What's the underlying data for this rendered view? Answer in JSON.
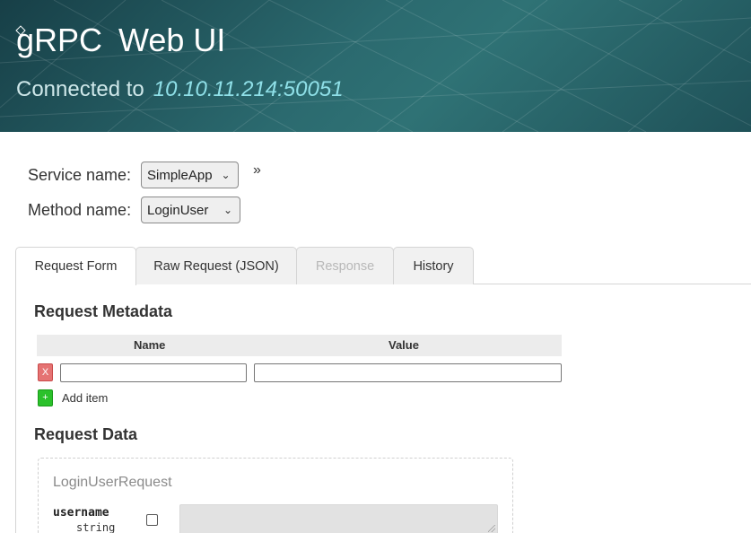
{
  "header": {
    "logo_text": "gRPC",
    "title": "Web UI",
    "connected_label": "Connected to",
    "address": "10.10.11.214:50051"
  },
  "selectors": {
    "service": {
      "label": "Service name:",
      "value": "SimpleApp"
    },
    "method": {
      "label": "Method name:",
      "value": "LoginUser"
    },
    "expand_glyph": "»"
  },
  "tabs": [
    {
      "label": "Request Form",
      "active": true,
      "disabled": false
    },
    {
      "label": "Raw Request (JSON)",
      "active": false,
      "disabled": false
    },
    {
      "label": "Response",
      "active": false,
      "disabled": true
    },
    {
      "label": "History",
      "active": false,
      "disabled": false
    }
  ],
  "metadata": {
    "heading": "Request Metadata",
    "columns": [
      "Name",
      "Value"
    ],
    "rows": [
      {
        "name": "",
        "value": ""
      }
    ],
    "remove_label": "X",
    "add_symbol": "+",
    "add_label": "Add item"
  },
  "request_data": {
    "heading": "Request Data",
    "message_type": "LoginUserRequest",
    "fields": [
      {
        "name": "username",
        "type": "string",
        "value": ""
      }
    ]
  },
  "colors": {
    "header_bg": "#2b6a6f",
    "address": "#8fe0e8",
    "remove_button": "#e57373",
    "add_button": "#2bc12b"
  }
}
